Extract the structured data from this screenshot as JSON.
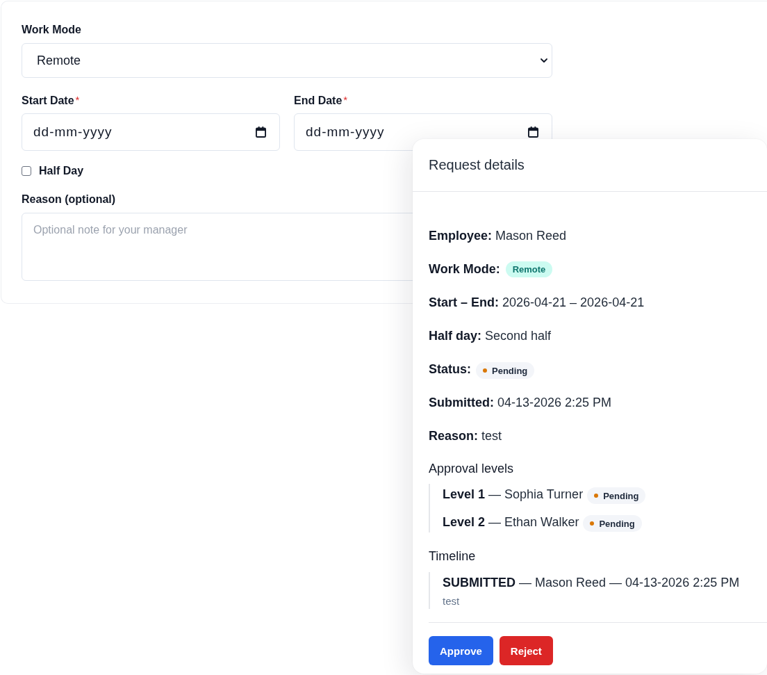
{
  "form": {
    "work_mode": {
      "label": "Work Mode",
      "value": "Remote"
    },
    "dates": [
      {
        "label": "Start Date",
        "required_mark": "*",
        "placeholder": "dd-mm-yyyy"
      },
      {
        "label": "End Date",
        "required_mark": "*",
        "placeholder": "dd-mm-yyyy"
      }
    ],
    "half_day": {
      "label": "Half Day",
      "checked": false
    },
    "reason": {
      "label": "Reason (optional)",
      "placeholder": "Optional note for your manager"
    }
  },
  "request_details": {
    "title": "Request details",
    "fields": [
      {
        "kind": "text",
        "label": "Employee:",
        "value": "Mason Reed"
      },
      {
        "kind": "mode_badge",
        "label": "Work Mode:",
        "value": "Remote"
      },
      {
        "kind": "text",
        "label": "Start – End:",
        "value": "2026-04-21 – 2026-04-21"
      },
      {
        "kind": "text",
        "label": "Half day:",
        "value": "Second half"
      },
      {
        "kind": "status_badge",
        "label": "Status:",
        "value": "Pending",
        "color": "#d97706"
      },
      {
        "kind": "text",
        "label": "Submitted:",
        "value": "04-13-2026 2:25 PM"
      },
      {
        "kind": "text",
        "label": "Reason:",
        "value": "test"
      }
    ],
    "approval_levels": {
      "heading": "Approval levels",
      "items": [
        {
          "text": "**Level 1** — Sophia Turner",
          "status": "Pending",
          "color": "#d97706"
        },
        {
          "text": "**Level 2** — Ethan Walker",
          "status": "Pending",
          "color": "#d97706"
        }
      ]
    },
    "timeline": {
      "heading": "Timeline",
      "items": [
        {
          "text": "**SUBMITTED** — Mason Reed — 04-13-2026 2:25 PM",
          "note": "test"
        }
      ]
    },
    "buttons": [
      {
        "label": "Approve",
        "kind": "primary"
      },
      {
        "label": "Reject",
        "kind": "danger"
      }
    ]
  }
}
